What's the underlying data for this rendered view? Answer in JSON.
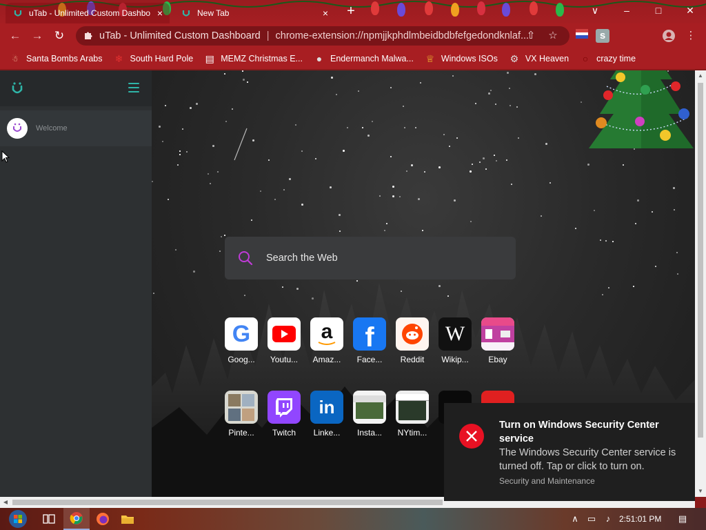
{
  "browser": {
    "tabs": [
      {
        "title": "uTab - Unlimited Custom Dashbo",
        "close": "×"
      },
      {
        "title": "New Tab",
        "close": "×"
      }
    ],
    "new_tab": "+",
    "window_controls": {
      "dropdown": "∨",
      "minimize": "–",
      "maximize": "□",
      "close": "✕"
    },
    "nav": {
      "back": "←",
      "forward": "→",
      "reload": "↻"
    },
    "omnibox": {
      "site": "uTab - Unlimited Custom Dashboard",
      "separator": "|",
      "url": "chrome-extension://npmjjkphdlmbeidbdbfefgedondknlaf..."
    },
    "toolbar_icons": [
      "share-icon",
      "star-icon",
      "extension-icon",
      "profile-icon",
      "menu-icon"
    ],
    "toolbar_glyphs": {
      "share": "⇧",
      "star": "☆",
      "s_ext": "s",
      "menu": "⋮"
    }
  },
  "bookmarks": [
    {
      "label": "Santa Bombs Arabs",
      "icon": "santa-icon",
      "glyph": "☃"
    },
    {
      "label": "South Hard Pole",
      "icon": "snowflake-icon",
      "glyph": "❄"
    },
    {
      "label": "MEMZ Christmas E...",
      "icon": "page-icon",
      "glyph": "▤"
    },
    {
      "label": "Endermanch Malwa...",
      "icon": "raccoon-icon",
      "glyph": "●"
    },
    {
      "label": "Windows ISOs",
      "icon": "trophy-icon",
      "glyph": "♕"
    },
    {
      "label": "VX Heaven",
      "icon": "vx-icon",
      "glyph": "⚙"
    },
    {
      "label": "crazy time",
      "icon": "blank-icon",
      "glyph": "○"
    }
  ],
  "sidebar": {
    "welcome": "Welcome"
  },
  "search": {
    "placeholder": "Search the Web"
  },
  "tiles_row1": [
    {
      "label": "Goog...",
      "icon": "google-icon"
    },
    {
      "label": "Youtu...",
      "icon": "youtube-icon"
    },
    {
      "label": "Amaz...",
      "icon": "amazon-icon"
    },
    {
      "label": "Face...",
      "icon": "facebook-icon"
    },
    {
      "label": "Reddit",
      "icon": "reddit-icon"
    },
    {
      "label": "Wikip...",
      "icon": "wikipedia-icon"
    },
    {
      "label": "Ebay",
      "icon": "ebay-icon"
    }
  ],
  "tiles_row2": [
    {
      "label": "Pinte...",
      "icon": "pinterest-thumb-icon"
    },
    {
      "label": "Twitch",
      "icon": "twitch-icon"
    },
    {
      "label": "Linke...",
      "icon": "linkedin-icon"
    },
    {
      "label": "Insta...",
      "icon": "instagram-thumb-icon"
    },
    {
      "label": "NYtim...",
      "icon": "nytimes-thumb-icon"
    }
  ],
  "tile_glyphs": {
    "google": "G",
    "amazon": "a",
    "facebook": "f",
    "wikipedia": "W",
    "linkedin": "in"
  },
  "toast": {
    "title": "Turn on Windows Security Center service",
    "body": "The Windows Security Center service is turned off. Tap or click to turn on.",
    "source": "Security and Maintenance"
  },
  "taskbar": {
    "clock": "2:51:01 PM",
    "tray": {
      "chevron": "∧",
      "network": "▭",
      "volume": "♪",
      "notifications": "▤"
    }
  },
  "colors": {
    "chrome_frame": "#a81e22",
    "accent_teal": "#2fb5a8",
    "search_purple": "#c03bd8",
    "toast_error": "#e81123"
  }
}
